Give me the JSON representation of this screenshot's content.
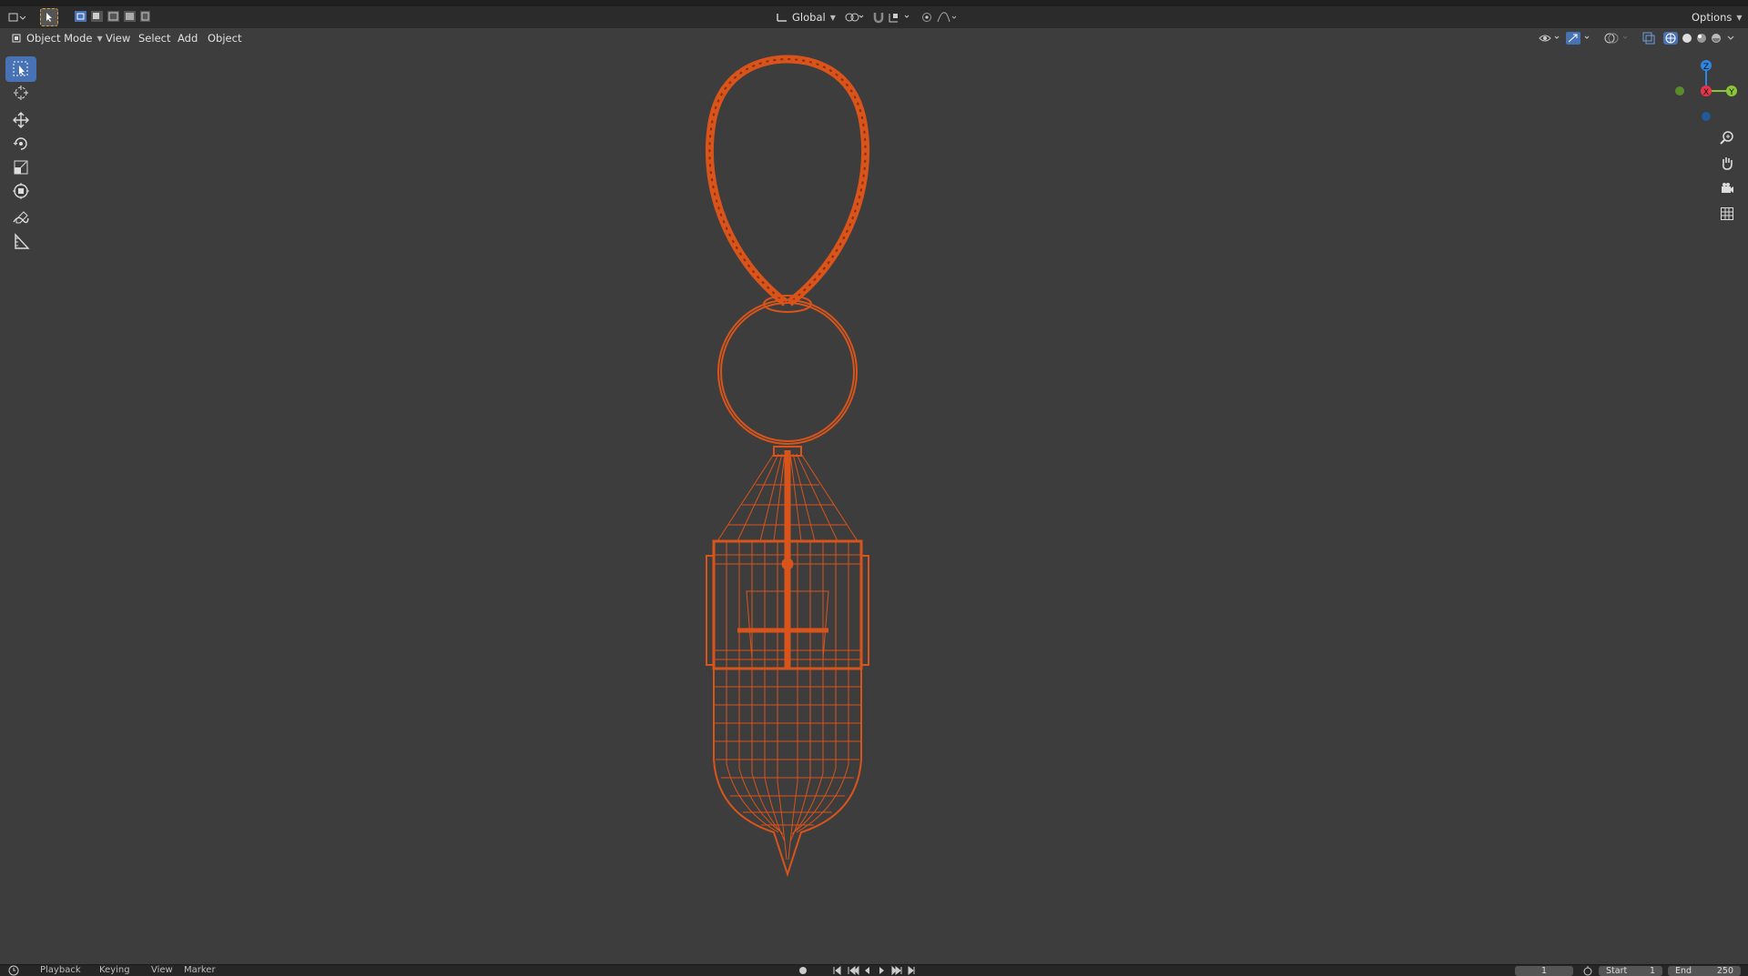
{
  "header": {
    "orientation_label": "Global",
    "options_label": "Options"
  },
  "viewport_header": {
    "mode_label": "Object Mode",
    "menu": [
      "View",
      "Select",
      "Add",
      "Object"
    ]
  },
  "tools": [
    {
      "name": "select-box",
      "icon": "cursor-arrow-icon",
      "active": true
    },
    {
      "name": "cursor",
      "icon": "crosshair-icon",
      "active": false
    },
    {
      "name": "move",
      "icon": "move-arrows-icon",
      "active": false
    },
    {
      "name": "rotate",
      "icon": "rotate-icon",
      "active": false
    },
    {
      "name": "scale",
      "icon": "scale-icon",
      "active": false
    },
    {
      "name": "transform",
      "icon": "transform-icon",
      "active": false
    },
    {
      "name": "annotate",
      "icon": "pencil-icon",
      "active": false
    },
    {
      "name": "measure",
      "icon": "ruler-icon",
      "active": false
    }
  ],
  "gizmo": {
    "x": "X",
    "y": "Y",
    "z": "Z",
    "colors": {
      "x": "#e8334a",
      "y": "#8bc638",
      "z": "#2f86e0"
    }
  },
  "timeline": {
    "menu": [
      "Playback",
      "Keying",
      "View",
      "Marker"
    ],
    "current_frame": "1",
    "start_label": "Start",
    "start_value": "1",
    "end_label": "End",
    "end_value": "250"
  },
  "colors": {
    "accent": "#4772b3",
    "selection_wire": "#d9541a",
    "background": "#3d3d3d"
  }
}
